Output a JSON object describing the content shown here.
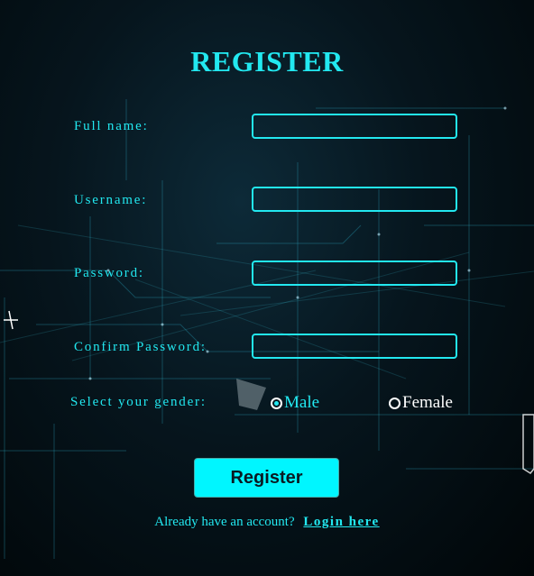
{
  "form": {
    "title": "REGISTER",
    "fields": [
      {
        "label": "Full name:",
        "value": ""
      },
      {
        "label": "Username:",
        "value": ""
      },
      {
        "label": "Password:",
        "value": ""
      },
      {
        "label": "Confirm Password:",
        "value": ""
      }
    ],
    "gender": {
      "label": "Select your gender:",
      "options": [
        {
          "label": "Male",
          "checked": true
        },
        {
          "label": "Female",
          "checked": false
        }
      ]
    },
    "submit_label": "Register",
    "footer_text": "Already have an account?",
    "login_link": "Login here"
  },
  "colors": {
    "accent": "#22e8f0",
    "button_bg": "#00f6ff",
    "background": "#02080c"
  }
}
